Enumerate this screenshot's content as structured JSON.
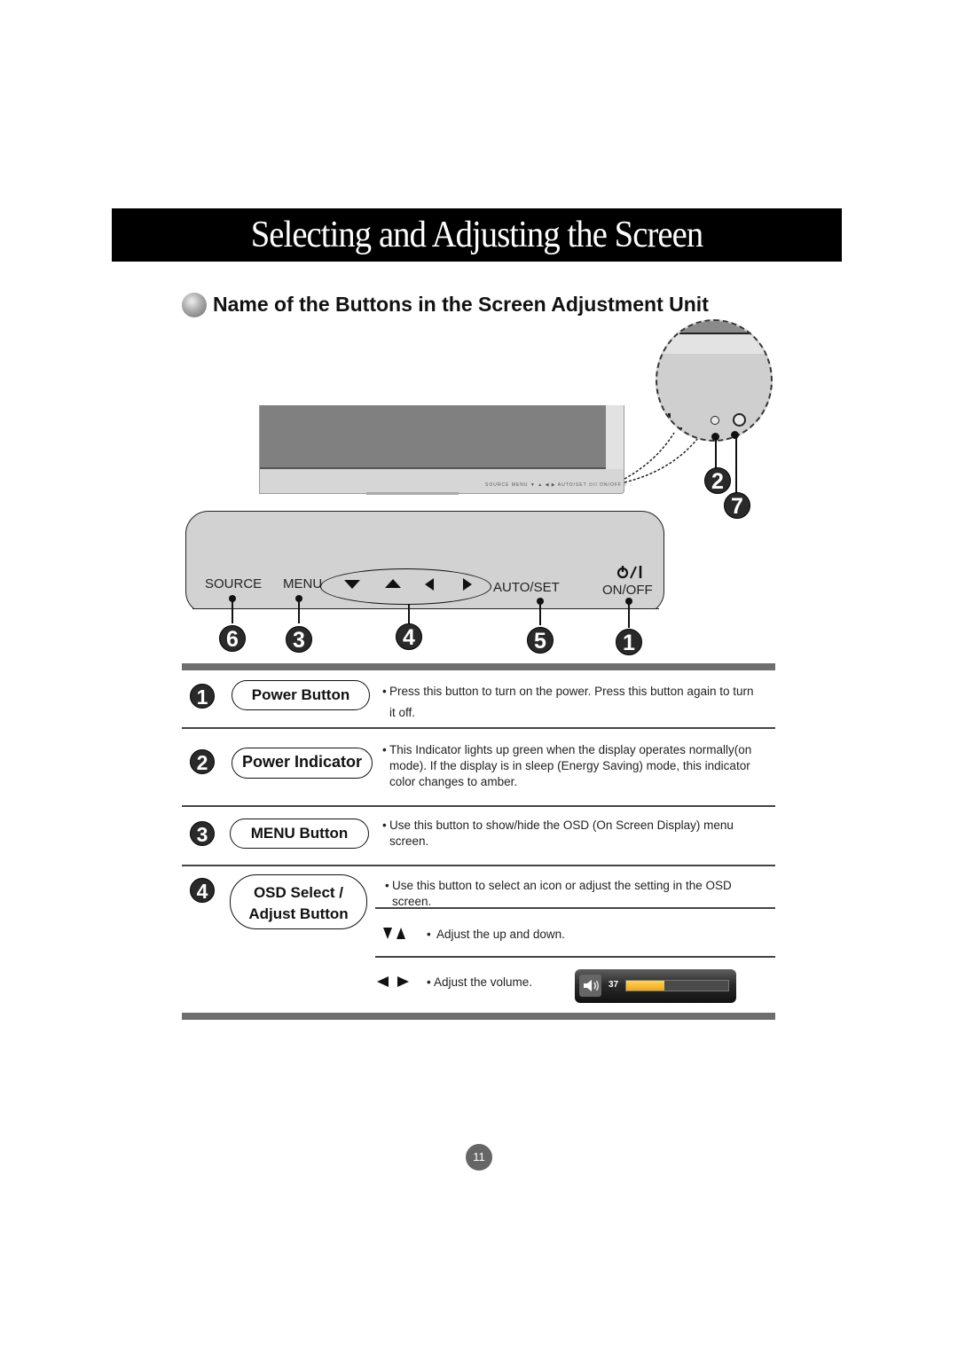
{
  "page": {
    "title": "Selecting and Adjusting the Screen",
    "section_title": "Name of the Buttons in the Screen Adjustment Unit",
    "page_number": "11"
  },
  "monitor": {
    "mini_control_labels": "SOURCE  MENU  ▼  ▲  ◀  ▶  AUTO/SET   ⏻/I ON/OFF  ○ ◌"
  },
  "zoom_callouts": [
    "2",
    "7"
  ],
  "control_panel": {
    "labels": {
      "source": "SOURCE",
      "menu": "MENU",
      "auto_set": "AUTO/SET",
      "power_symbol": "ȫ/I",
      "on_off": "ON/OFF"
    },
    "callouts": {
      "source": "6",
      "menu": "3",
      "arrows": "4",
      "auto_set": "5",
      "on_off": "1"
    }
  },
  "table": {
    "rows": [
      {
        "number": "1",
        "name": "Power Button",
        "description": "Press this button to turn on the power. Press this button again to turn it off."
      },
      {
        "number": "2",
        "name": "Power Indicator",
        "description": "This Indicator lights up green when the display operates normally(on mode). If the display is in sleep (Energy Saving) mode, this indicator color changes to amber."
      },
      {
        "number": "3",
        "name": "MENU Button",
        "description": "Use this button to show/hide the OSD (On Screen Display) menu screen."
      },
      {
        "number": "4",
        "name_line1": "OSD Select /",
        "name_line2": "Adjust Button",
        "description": "Use this button to select an icon or adjust the setting in the OSD screen.",
        "sub_items": [
          {
            "icons": "down-up-arrows",
            "text": "Adjust the up and down."
          },
          {
            "icons": "left-right-arrows",
            "text": "Adjust the volume."
          }
        ]
      }
    ]
  },
  "volume_osd": {
    "value_label": "37",
    "level_percent": 37,
    "fill_color": "#F5B82A"
  }
}
